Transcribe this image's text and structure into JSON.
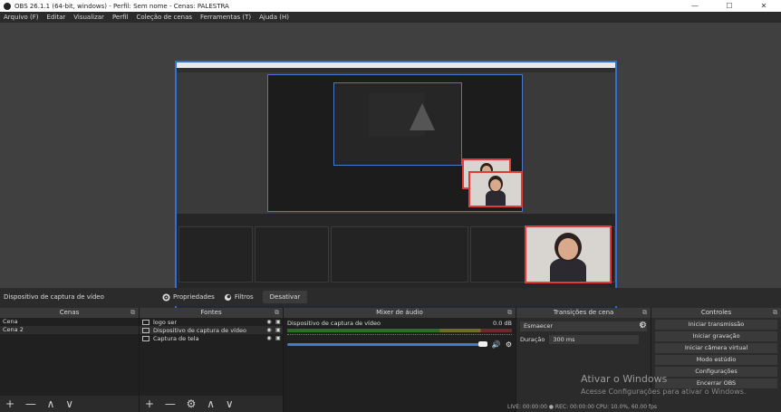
{
  "window": {
    "title": "OBS 26.1.1 (64-bit, windows) - Perfil: Sem nome - Cenas: PALESTRA",
    "minimize": "—",
    "maximize": "☐",
    "close": "✕"
  },
  "menu": [
    "Arquivo (F)",
    "Editar",
    "Visualizar",
    "Perfil",
    "Coleção de cenas",
    "Ferramentas (T)",
    "Ajuda (H)"
  ],
  "sourcebar": {
    "label": "Dispositivo de captura de vídeo",
    "properties": "Propriedades",
    "filters": "Filtros",
    "deactivate": "Desativar"
  },
  "scenes": {
    "header": "Cenas",
    "items": [
      "Cena",
      "Cena 2"
    ],
    "footer": "+ — ∧ ∨"
  },
  "sources": {
    "header": "Fontes",
    "items": [
      "logo ser",
      "Dispositivo de captura de vídeo",
      "Captura de tela"
    ],
    "footer": "+ — ⚙ ∧ ∨"
  },
  "mixer": {
    "header": "Mixer de áudio",
    "channel": "Dispositivo de captura de vídeo",
    "db": "0.0 dB"
  },
  "transitions": {
    "header": "Transições de cena",
    "selected": "Esmaecer",
    "duration_label": "Duração",
    "duration_value": "300 ms"
  },
  "controls": {
    "header": "Controles",
    "buttons": [
      "Iniciar transmissão",
      "Iniciar gravação",
      "Iniciar câmera virtual",
      "Modo estúdio",
      "Configurações",
      "Encerrar OBS"
    ]
  },
  "watermark": {
    "line1": "Ativar o Windows",
    "line2": "Acesse Configurações para ativar o Windows."
  },
  "status": "LIVE: 00:00:00   ●  REC: 00:00:00   CPU: 10.0%, 60.00 fps",
  "icons": {
    "properties": "gear-icon",
    "filters": "filter-icon",
    "speaker": "speaker-icon",
    "settings": "gear-icon"
  },
  "colors": {
    "selection_border": "#e23b3b",
    "preview_border": "#2f6fd6",
    "volume_slider": "#3e7bd9"
  }
}
